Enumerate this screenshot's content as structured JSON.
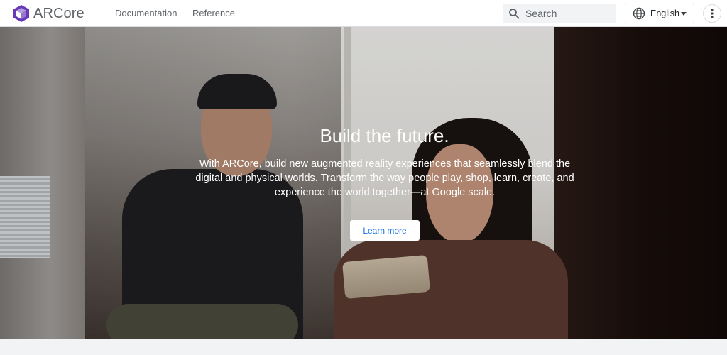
{
  "header": {
    "brand": "ARCore",
    "nav": [
      {
        "label": "Documentation"
      },
      {
        "label": "Reference"
      }
    ],
    "search": {
      "placeholder": "Search",
      "icon": "search-icon"
    },
    "language": {
      "label": "English",
      "icon": "globe-icon"
    },
    "more_icon": "more-vert-icon"
  },
  "hero": {
    "title": "Build the future.",
    "description": "With ARCore, build new augmented reality experiences that seamlessly blend the digital and physical worlds. Transform the way people play, shop, learn, create, and experience the world together—at Google scale.",
    "cta_label": "Learn more"
  },
  "colors": {
    "brand_purple": "#673ab7",
    "link_blue": "#1a73e8",
    "header_text": "#5f6368"
  }
}
